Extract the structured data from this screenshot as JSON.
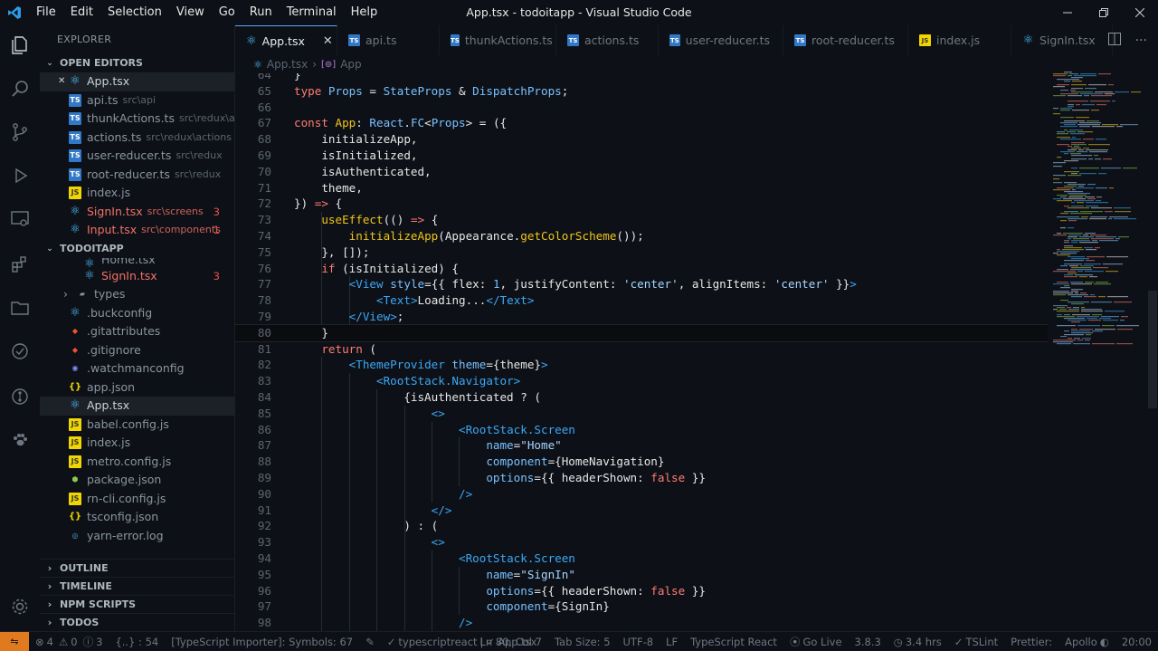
{
  "window": {
    "title": "App.tsx - todoitapp - Visual Studio Code",
    "menu": [
      "File",
      "Edit",
      "Selection",
      "View",
      "Go",
      "Run",
      "Terminal",
      "Help"
    ]
  },
  "sidebar": {
    "title": "EXPLORER",
    "open_editors_label": "OPEN EDITORS",
    "open_editors": [
      {
        "name": "App.tsx",
        "path": "",
        "icon": "react",
        "badge": "",
        "error": false,
        "selected": true,
        "close": "✕"
      },
      {
        "name": "api.ts",
        "path": "src\\api",
        "icon": "ts",
        "badge": "",
        "error": false
      },
      {
        "name": "thunkActions.ts",
        "path": "src\\redux\\acti...",
        "icon": "ts",
        "badge": "",
        "error": false
      },
      {
        "name": "actions.ts",
        "path": "src\\redux\\actions",
        "icon": "ts",
        "badge": "",
        "error": false
      },
      {
        "name": "user-reducer.ts",
        "path": "src\\redux",
        "icon": "ts",
        "badge": "",
        "error": false
      },
      {
        "name": "root-reducer.ts",
        "path": "src\\redux",
        "icon": "ts",
        "badge": "",
        "error": false
      },
      {
        "name": "index.js",
        "path": "",
        "icon": "js",
        "badge": "",
        "error": false
      },
      {
        "name": "SignIn.tsx",
        "path": "src\\screens",
        "icon": "react",
        "badge": "3",
        "error": true
      },
      {
        "name": "Input.tsx",
        "path": "src\\components",
        "icon": "react",
        "badge": "1",
        "error": true
      }
    ],
    "project_label": "TODOITAPP",
    "project_files": [
      {
        "name": "Home.tsx",
        "icon": "react",
        "indent": 48,
        "badge": "",
        "error": false,
        "partial": true
      },
      {
        "name": "SignIn.tsx",
        "icon": "react",
        "indent": 48,
        "badge": "3",
        "error": true
      },
      {
        "name": "types",
        "icon": "folder",
        "indent": 26,
        "badge": "",
        "error": false,
        "chevron": "›"
      },
      {
        "name": ".buckconfig",
        "icon": "react",
        "indent": 32
      },
      {
        "name": ".gitattributes",
        "icon": "git",
        "indent": 32
      },
      {
        "name": ".gitignore",
        "icon": "git",
        "indent": 32
      },
      {
        "name": ".watchmanconfig",
        "icon": "watchman",
        "indent": 32
      },
      {
        "name": "app.json",
        "icon": "json",
        "indent": 32
      },
      {
        "name": "App.tsx",
        "icon": "react",
        "indent": 32,
        "selected": true
      },
      {
        "name": "babel.config.js",
        "icon": "js",
        "indent": 32
      },
      {
        "name": "index.js",
        "icon": "js",
        "indent": 32
      },
      {
        "name": "metro.config.js",
        "icon": "js",
        "indent": 32
      },
      {
        "name": "package.json",
        "icon": "node",
        "indent": 32
      },
      {
        "name": "rn-cli.config.js",
        "icon": "js",
        "indent": 32
      },
      {
        "name": "tsconfig.json",
        "icon": "json",
        "indent": 32
      },
      {
        "name": "yarn-error.log",
        "icon": "yarn",
        "indent": 32
      }
    ],
    "collapsed_sections": [
      "OUTLINE",
      "TIMELINE",
      "NPM SCRIPTS",
      "TODOS"
    ]
  },
  "tabs": [
    {
      "label": "App.tsx",
      "icon": "react",
      "active": true
    },
    {
      "label": "api.ts",
      "icon": "ts"
    },
    {
      "label": "thunkActions.ts",
      "icon": "ts"
    },
    {
      "label": "actions.ts",
      "icon": "ts"
    },
    {
      "label": "user-reducer.ts",
      "icon": "ts"
    },
    {
      "label": "root-reducer.ts",
      "icon": "ts"
    },
    {
      "label": "index.js",
      "icon": "js"
    },
    {
      "label": "SignIn.tsx",
      "icon": "react"
    }
  ],
  "breadcrumb": [
    "App.tsx",
    "App"
  ],
  "editor": {
    "current_line": 80,
    "lines": [
      {
        "n": 64,
        "t": [
          [
            "pu",
            "}"
          ]
        ]
      },
      {
        "n": 65,
        "t": [
          [
            "kw",
            "type "
          ],
          [
            "ty",
            "Props"
          ],
          [
            "pl",
            " = "
          ],
          [
            "ty",
            "StateProps"
          ],
          [
            "pl",
            " & "
          ],
          [
            "ty",
            "DispatchProps"
          ],
          [
            "pl",
            ";"
          ]
        ]
      },
      {
        "n": 66,
        "t": []
      },
      {
        "n": 67,
        "t": [
          [
            "kw",
            "const "
          ],
          [
            "fn",
            "App"
          ],
          [
            "pl",
            ": "
          ],
          [
            "ty",
            "React"
          ],
          [
            "pl",
            "."
          ],
          [
            "ty",
            "FC"
          ],
          [
            "pl",
            "<"
          ],
          [
            "ty",
            "Props"
          ],
          [
            "pl",
            "> = ({"
          ]
        ]
      },
      {
        "n": 68,
        "t": [
          [
            "pl",
            "    initializeApp,"
          ]
        ]
      },
      {
        "n": 69,
        "t": [
          [
            "pl",
            "    isInitialized,"
          ]
        ]
      },
      {
        "n": 70,
        "t": [
          [
            "pl",
            "    isAuthenticated,"
          ]
        ]
      },
      {
        "n": 71,
        "t": [
          [
            "pl",
            "    theme,"
          ]
        ]
      },
      {
        "n": 72,
        "t": [
          [
            "pl",
            "}) "
          ],
          [
            "kw",
            "=>"
          ],
          [
            "pl",
            " {"
          ]
        ]
      },
      {
        "n": 73,
        "t": [
          [
            "pl",
            "    "
          ],
          [
            "fn",
            "useEffect"
          ],
          [
            "pl",
            "(() "
          ],
          [
            "kw",
            "=>"
          ],
          [
            "pl",
            " {"
          ]
        ]
      },
      {
        "n": 74,
        "t": [
          [
            "pl",
            "        "
          ],
          [
            "fn",
            "initializeApp"
          ],
          [
            "pl",
            "(Appearance."
          ],
          [
            "fn",
            "getColorScheme"
          ],
          [
            "pl",
            "());"
          ]
        ]
      },
      {
        "n": 75,
        "t": [
          [
            "pl",
            "    }, []);"
          ]
        ]
      },
      {
        "n": 76,
        "t": [
          [
            "pl",
            "    "
          ],
          [
            "kw",
            "if"
          ],
          [
            "pl",
            " (isInitialized) {"
          ]
        ]
      },
      {
        "n": 77,
        "t": [
          [
            "pl",
            "        "
          ],
          [
            "br",
            "<"
          ],
          [
            "tag",
            "View"
          ],
          [
            "at",
            " style"
          ],
          [
            "pl",
            "={{ flex: "
          ],
          [
            "ty",
            "1"
          ],
          [
            "pl",
            ", justifyContent: "
          ],
          [
            "st",
            "'center'"
          ],
          [
            "pl",
            ", alignItems: "
          ],
          [
            "st",
            "'center'"
          ],
          [
            "pl",
            " }}"
          ],
          [
            "br",
            ">"
          ]
        ]
      },
      {
        "n": 78,
        "t": [
          [
            "pl",
            "            "
          ],
          [
            "br",
            "<"
          ],
          [
            "tag",
            "Text"
          ],
          [
            "br",
            ">"
          ],
          [
            "pl",
            "Loading..."
          ],
          [
            "br",
            "</"
          ],
          [
            "tag",
            "Text"
          ],
          [
            "br",
            ">"
          ]
        ]
      },
      {
        "n": 79,
        "t": [
          [
            "pl",
            "        "
          ],
          [
            "br",
            "</"
          ],
          [
            "tag",
            "View"
          ],
          [
            "br",
            ">"
          ],
          [
            "pl",
            ";"
          ]
        ]
      },
      {
        "n": 80,
        "t": [
          [
            "pl",
            "    }"
          ]
        ]
      },
      {
        "n": 81,
        "t": [
          [
            "pl",
            "    "
          ],
          [
            "kw",
            "return"
          ],
          [
            "pl",
            " ("
          ]
        ]
      },
      {
        "n": 82,
        "t": [
          [
            "pl",
            "        "
          ],
          [
            "br",
            "<"
          ],
          [
            "tag",
            "ThemeProvider"
          ],
          [
            "at",
            " theme"
          ],
          [
            "pl",
            "={theme}"
          ],
          [
            "br",
            ">"
          ]
        ]
      },
      {
        "n": 83,
        "t": [
          [
            "pl",
            "            "
          ],
          [
            "br",
            "<"
          ],
          [
            "tag",
            "RootStack.Navigator"
          ],
          [
            "br",
            ">"
          ]
        ]
      },
      {
        "n": 84,
        "t": [
          [
            "pl",
            "                {isAuthenticated ? ("
          ]
        ]
      },
      {
        "n": 85,
        "t": [
          [
            "pl",
            "                    "
          ],
          [
            "br",
            "<>"
          ]
        ]
      },
      {
        "n": 86,
        "t": [
          [
            "pl",
            "                        "
          ],
          [
            "br",
            "<"
          ],
          [
            "tag",
            "RootStack.Screen"
          ]
        ]
      },
      {
        "n": 87,
        "t": [
          [
            "pl",
            "                            "
          ],
          [
            "at",
            "name"
          ],
          [
            "pl",
            "="
          ],
          [
            "st",
            "\"Home\""
          ]
        ]
      },
      {
        "n": 88,
        "t": [
          [
            "pl",
            "                            "
          ],
          [
            "at",
            "component"
          ],
          [
            "pl",
            "={HomeNavigation}"
          ]
        ]
      },
      {
        "n": 89,
        "t": [
          [
            "pl",
            "                            "
          ],
          [
            "at",
            "options"
          ],
          [
            "pl",
            "={{ headerShown: "
          ],
          [
            "bo",
            "false"
          ],
          [
            "pl",
            " }}"
          ]
        ]
      },
      {
        "n": 90,
        "t": [
          [
            "pl",
            "                        "
          ],
          [
            "br",
            "/>"
          ]
        ]
      },
      {
        "n": 91,
        "t": [
          [
            "pl",
            "                    "
          ],
          [
            "br",
            "</>"
          ]
        ]
      },
      {
        "n": 92,
        "t": [
          [
            "pl",
            "                ) : ("
          ]
        ]
      },
      {
        "n": 93,
        "t": [
          [
            "pl",
            "                    "
          ],
          [
            "br",
            "<>"
          ]
        ]
      },
      {
        "n": 94,
        "t": [
          [
            "pl",
            "                        "
          ],
          [
            "br",
            "<"
          ],
          [
            "tag",
            "RootStack.Screen"
          ]
        ]
      },
      {
        "n": 95,
        "t": [
          [
            "pl",
            "                            "
          ],
          [
            "at",
            "name"
          ],
          [
            "pl",
            "="
          ],
          [
            "st",
            "\"SignIn\""
          ]
        ]
      },
      {
        "n": 96,
        "t": [
          [
            "pl",
            "                            "
          ],
          [
            "at",
            "options"
          ],
          [
            "pl",
            "={{ headerShown: "
          ],
          [
            "bo",
            "false"
          ],
          [
            "pl",
            " }}"
          ]
        ]
      },
      {
        "n": 97,
        "t": [
          [
            "pl",
            "                            "
          ],
          [
            "at",
            "component"
          ],
          [
            "pl",
            "={SignIn}"
          ]
        ]
      },
      {
        "n": 98,
        "t": [
          [
            "pl",
            "                        "
          ],
          [
            "br",
            "/>"
          ]
        ]
      }
    ]
  },
  "status": {
    "errors": "4",
    "warnings": "0",
    "info": "3",
    "col_info": "{..} : 54",
    "importer": "[TypeScript Importer]: Symbols: 67",
    "language_mode": "typescriptreact",
    "file": "App.tsx",
    "position": "Ln 80, Col 7",
    "tab_size": "Tab Size: 5",
    "encoding": "UTF-8",
    "eol": "LF",
    "language": "TypeScript React",
    "golive": "Go Live",
    "ts_version": "3.8.3",
    "timing": "3.4 hrs",
    "tslint": "TSLint",
    "prettier": "Prettier:",
    "apollo": "Apollo",
    "time": "20:00"
  },
  "colors": {
    "accent": "#58a6ff",
    "error": "#f47067",
    "remote": "#e07a1f",
    "background": "#0d1117"
  }
}
